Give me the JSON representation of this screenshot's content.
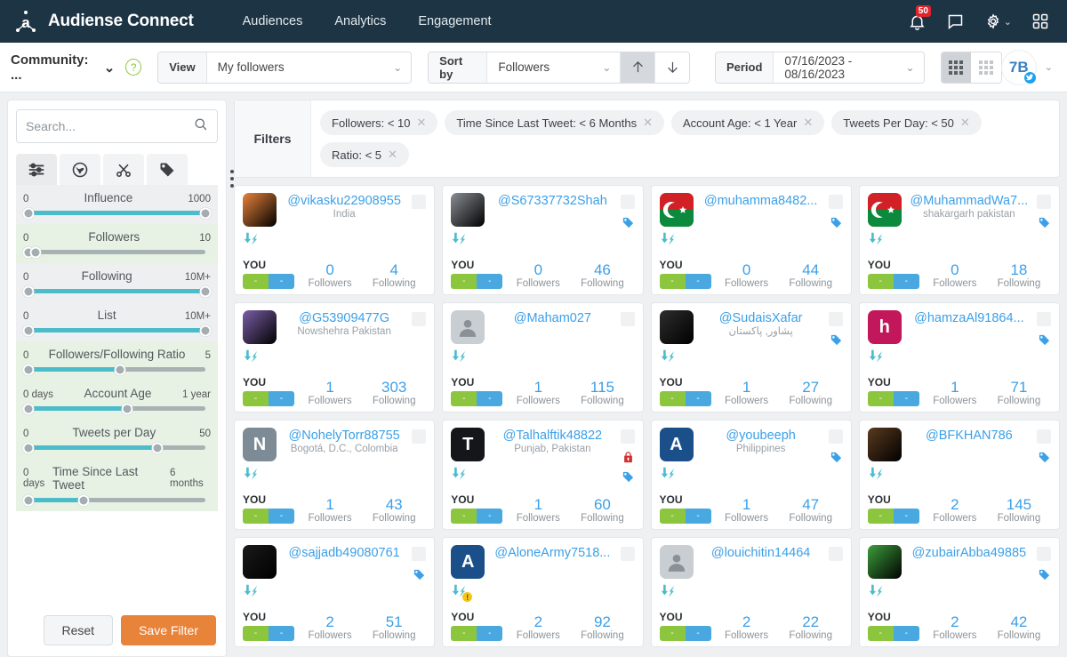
{
  "topnav": {
    "brand": "Audiense Connect",
    "links": [
      "Audiences",
      "Analytics",
      "Engagement"
    ],
    "notification_count": "50"
  },
  "toolbar": {
    "community_label": "Community: ...",
    "help": "?",
    "view_label": "View",
    "view_value": "My followers",
    "sort_label": "Sort by",
    "sort_value": "Followers",
    "period_label": "Period",
    "period_value": "07/16/2023 - 08/16/2023",
    "avatar_initials": "7B"
  },
  "sidebar": {
    "search_placeholder": "Search...",
    "tabs": [
      "sliders-icon",
      "globe-icon",
      "scissors-icon",
      "tag-icon"
    ],
    "sliders": [
      {
        "title": "Influence",
        "min": "0",
        "max": "1000",
        "fill_pct": 100,
        "knob_pct": 100,
        "highlight": false
      },
      {
        "title": "Followers",
        "min": "0",
        "max": "10",
        "fill_pct": 4,
        "knob_pct": 4,
        "highlight": true
      },
      {
        "title": "Following",
        "min": "0",
        "max": "10M+",
        "fill_pct": 100,
        "knob_pct": 100,
        "highlight": false
      },
      {
        "title": "List",
        "min": "0",
        "max": "10M+",
        "fill_pct": 100,
        "knob_pct": 100,
        "highlight": false
      },
      {
        "title": "Followers/Following Ratio",
        "min": "0",
        "max": "5",
        "fill_pct": 52,
        "knob_pct": 52,
        "highlight": true
      },
      {
        "title": "Account Age",
        "min": "0 days",
        "max": "1 year",
        "fill_pct": 56,
        "knob_pct": 56,
        "highlight": true
      },
      {
        "title": "Tweets per Day",
        "min": "0",
        "max": "50",
        "fill_pct": 73,
        "knob_pct": 73,
        "highlight": true
      },
      {
        "title": "Time Since Last Tweet",
        "min": "0 days",
        "max": "6 months",
        "fill_pct": 31,
        "knob_pct": 31,
        "highlight": true
      }
    ],
    "reset_label": "Reset",
    "save_label": "Save Filter"
  },
  "filters": {
    "label": "Filters",
    "chips": [
      "Followers: < 10",
      "Time Since Last Tweet: < 6 Months",
      "Account Age: < 1 Year",
      "Tweets Per Day: < 50",
      "Ratio: < 5"
    ]
  },
  "stat_labels": {
    "followers": "Followers",
    "following": "Following",
    "you": "YOU"
  },
  "cards": [
    {
      "handle": "@vikasku22908955",
      "location": "India",
      "followers": "0",
      "following": "4",
      "avatar_type": "photo",
      "avatar_color": "#e8833a",
      "initial": "",
      "tag": false,
      "lock": false,
      "warn": false
    },
    {
      "handle": "@S67337732Shah",
      "location": "",
      "followers": "0",
      "following": "46",
      "avatar_type": "photo",
      "avatar_color": "#8a8f95",
      "initial": "",
      "tag": true,
      "lock": false,
      "warn": false
    },
    {
      "handle": "@muhamma8482...",
      "location": "",
      "followers": "0",
      "following": "44",
      "avatar_type": "flag",
      "avatar_color": "#d12026",
      "initial": "",
      "tag": true,
      "lock": false,
      "warn": false
    },
    {
      "handle": "@MuhammadWa7...",
      "location": "shakargarh pakistan",
      "followers": "0",
      "following": "18",
      "avatar_type": "flag",
      "avatar_color": "#d12026",
      "initial": "",
      "tag": true,
      "lock": false,
      "warn": false
    },
    {
      "handle": "@G53909477G",
      "location": "Nowshehra Pakistan",
      "followers": "1",
      "following": "303",
      "avatar_type": "photo",
      "avatar_color": "#7b5ea8",
      "initial": "",
      "tag": false,
      "lock": false,
      "warn": false
    },
    {
      "handle": "@Maham027",
      "location": "",
      "followers": "1",
      "following": "115",
      "avatar_type": "placeholder",
      "avatar_color": "#c9ced2",
      "initial": "",
      "tag": false,
      "lock": false,
      "warn": false
    },
    {
      "handle": "@SudaisXafar",
      "location": "پشاور, پاکستان",
      "followers": "1",
      "following": "27",
      "avatar_type": "photo",
      "avatar_color": "#2d2d2d",
      "initial": "",
      "tag": true,
      "lock": false,
      "warn": false
    },
    {
      "handle": "@hamzaAl91864...",
      "location": "",
      "followers": "1",
      "following": "71",
      "avatar_type": "initial",
      "avatar_color": "#c2185b",
      "initial": "h",
      "tag": true,
      "lock": false,
      "warn": false
    },
    {
      "handle": "@NohelyTorr88755",
      "location": "Bogotá, D.C., Colombia",
      "followers": "1",
      "following": "43",
      "avatar_type": "initial",
      "avatar_color": "#7d8b96",
      "initial": "N",
      "tag": false,
      "lock": false,
      "warn": false
    },
    {
      "handle": "@Talhalftik48822",
      "location": "Punjab, Pakistan",
      "followers": "1",
      "following": "60",
      "avatar_type": "initial",
      "avatar_color": "#14161a",
      "initial": "T",
      "tag": true,
      "lock": true,
      "warn": false
    },
    {
      "handle": "@youbeeph",
      "location": "Philippines",
      "followers": "1",
      "following": "47",
      "avatar_type": "initial",
      "avatar_color": "#1b4f8a",
      "initial": "A",
      "tag": true,
      "lock": false,
      "warn": false
    },
    {
      "handle": "@BFKHAN786",
      "location": "",
      "followers": "2",
      "following": "145",
      "avatar_type": "photo",
      "avatar_color": "#5a3a1e",
      "initial": "",
      "tag": true,
      "lock": false,
      "warn": false
    },
    {
      "handle": "@sajjadb49080761",
      "location": "",
      "followers": "2",
      "following": "51",
      "avatar_type": "photo",
      "avatar_color": "#1a1a1a",
      "initial": "",
      "tag": true,
      "lock": false,
      "warn": false
    },
    {
      "handle": "@AloneArmy7518...",
      "location": "",
      "followers": "2",
      "following": "92",
      "avatar_type": "initial",
      "avatar_color": "#1b4f8a",
      "initial": "A",
      "tag": false,
      "lock": false,
      "warn": true
    },
    {
      "handle": "@louichitin14464",
      "location": "",
      "followers": "2",
      "following": "22",
      "avatar_type": "placeholder",
      "avatar_color": "#c9ced2",
      "initial": "",
      "tag": false,
      "lock": false,
      "warn": false
    },
    {
      "handle": "@zubairAbba49885",
      "location": "",
      "followers": "2",
      "following": "42",
      "avatar_type": "photo",
      "avatar_color": "#3c9e3c",
      "initial": "",
      "tag": true,
      "lock": false,
      "warn": false
    }
  ]
}
